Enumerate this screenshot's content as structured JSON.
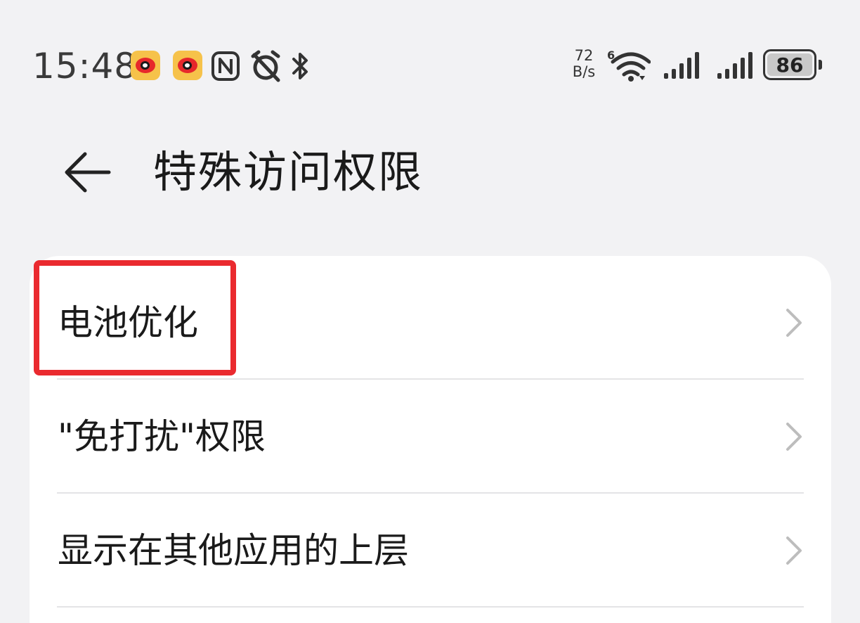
{
  "status_bar": {
    "time": "15:48",
    "net_speed_value": "72",
    "net_speed_unit": "B/s",
    "battery_level": "86",
    "icons": [
      "weibo-icon",
      "weibo-icon",
      "nfc-icon",
      "alarm-off-icon",
      "bluetooth-icon",
      "wifi6-icon",
      "signal-icon",
      "signal-icon",
      "battery-icon"
    ]
  },
  "header": {
    "title": "特殊访问权限",
    "back_icon": "back-arrow-icon"
  },
  "settings": {
    "items": [
      {
        "label": "电池优化",
        "icon": "chevron-right-icon"
      },
      {
        "label": "\"免打扰\"权限",
        "icon": "chevron-right-icon"
      },
      {
        "label": "显示在其他应用的上层",
        "icon": "chevron-right-icon"
      }
    ]
  },
  "highlight_color": "#ea2a2f"
}
